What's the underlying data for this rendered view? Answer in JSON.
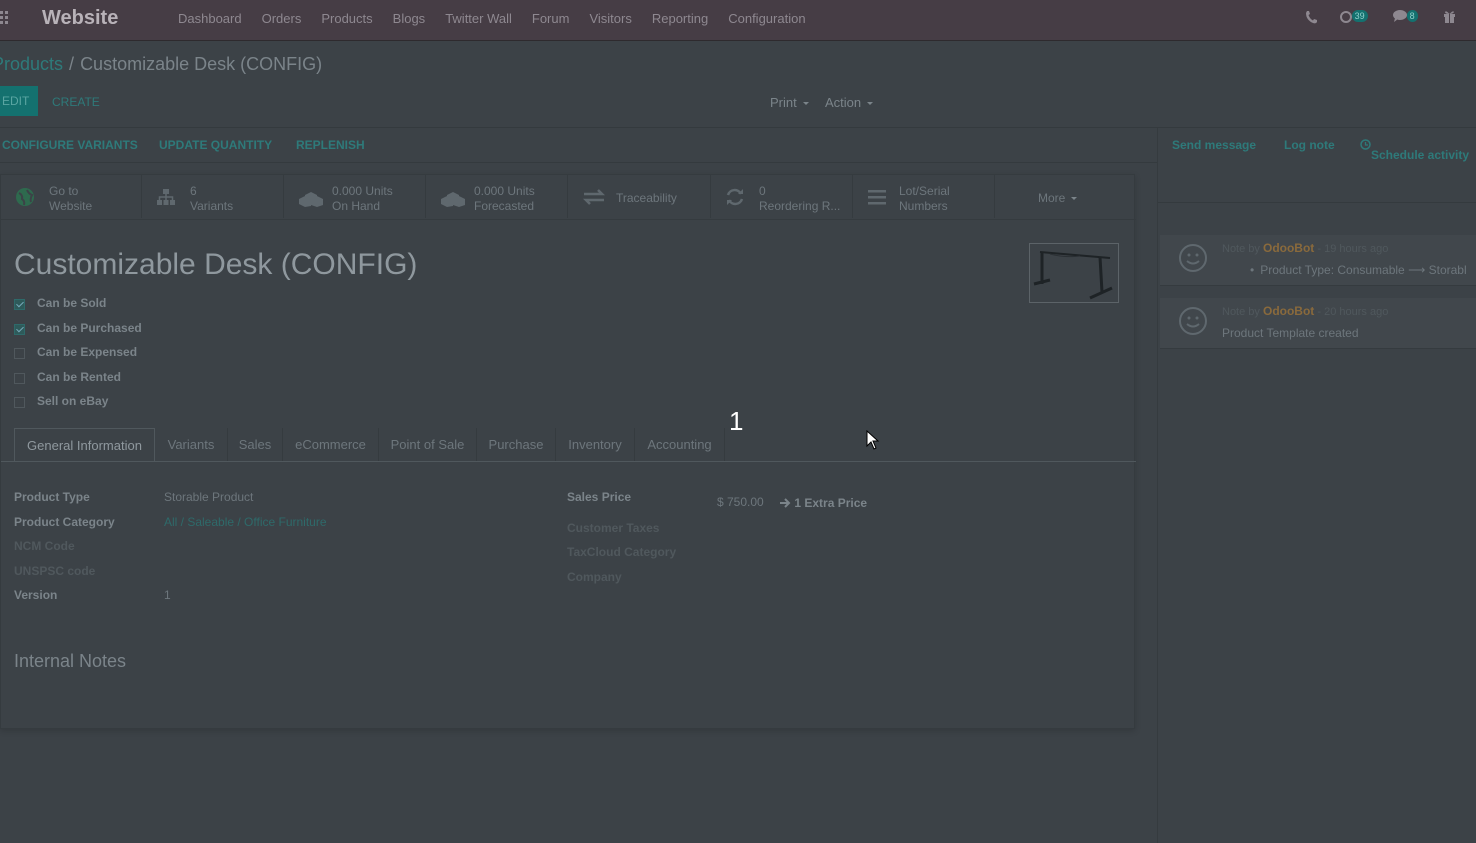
{
  "navbar": {
    "brand": "Website",
    "menu": [
      "Dashboard",
      "Orders",
      "Products",
      "Blogs",
      "Twitter Wall",
      "Forum",
      "Visitors",
      "Reporting",
      "Configuration"
    ],
    "activity_badge": "39",
    "messages_badge": "8"
  },
  "breadcrumb": {
    "parent": "Products",
    "separator": "/",
    "current": "Customizable Desk (CONFIG)"
  },
  "buttons": {
    "edit": "EDIT",
    "create": "CREATE",
    "print": "Print",
    "action": "Action"
  },
  "statusbar": {
    "configure_variants": "CONFIGURE VARIANTS",
    "update_quantity": "UPDATE QUANTITY",
    "replenish": "REPLENISH"
  },
  "smart_buttons": [
    {
      "line1": "Go to",
      "line2": "Website",
      "icon": "globe-icon"
    },
    {
      "line1": "6",
      "line2": "Variants",
      "icon": "sitemap-icon"
    },
    {
      "line1": "0.000 Units",
      "line2": "On Hand",
      "icon": "cubes-icon"
    },
    {
      "line1": "0.000 Units",
      "line2": "Forecasted",
      "icon": "cubes-icon"
    },
    {
      "line1": "Traceability",
      "line2": "",
      "icon": "exchange-icon"
    },
    {
      "line1": "0",
      "line2": "Reordering R...",
      "icon": "refresh-icon"
    },
    {
      "line1": "Lot/Serial",
      "line2": "Numbers",
      "icon": "bars-icon"
    },
    {
      "line1": "More",
      "line2": "",
      "icon": "caret-down-icon"
    }
  ],
  "product": {
    "name": "Customizable Desk (CONFIG)",
    "checkboxes": [
      {
        "label": "Can be Sold",
        "checked": true
      },
      {
        "label": "Can be Purchased",
        "checked": true
      },
      {
        "label": "Can be Expensed",
        "checked": false
      },
      {
        "label": "Can be Rented",
        "checked": false
      },
      {
        "label": "Sell on eBay",
        "checked": false
      }
    ]
  },
  "tabs": [
    "General Information",
    "Variants",
    "Sales",
    "eCommerce",
    "Point of Sale",
    "Purchase",
    "Inventory",
    "Accounting"
  ],
  "general_info": {
    "product_type_label": "Product Type",
    "product_type": "Storable Product",
    "product_category_label": "Product Category",
    "product_category": "All / Saleable / Office Furniture",
    "ncm_label": "NCM Code",
    "unspsc_label": "UNSPSC code",
    "version_label": "Version",
    "version": "1",
    "sales_price_label": "Sales Price",
    "sales_price": "$ 750.00",
    "extra_price": "1 Extra Price",
    "customer_taxes_label": "Customer Taxes",
    "taxcloud_label": "TaxCloud Category",
    "company_label": "Company"
  },
  "internal_notes": "Internal Notes",
  "overlay_step": "1",
  "chatter": {
    "send_message": "Send message",
    "log_note": "Log note",
    "schedule_activity": "Schedule activity",
    "messages": [
      {
        "prefix": "Note by",
        "author": "OdooBot",
        "time": "- 19 hours ago",
        "body": "Product Type: Consumable ⟶ Storabl",
        "bullet": true
      },
      {
        "prefix": "Note by",
        "author": "OdooBot",
        "time": "- 20 hours ago",
        "body": "Product Template created",
        "bullet": false
      }
    ]
  },
  "colors": {
    "navbar": "#463d45",
    "background": "#3c4247",
    "accent": "#14716f"
  }
}
